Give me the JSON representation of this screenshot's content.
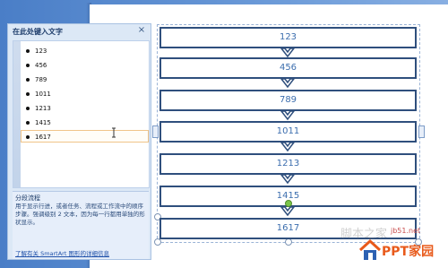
{
  "text_pane": {
    "title": "在此处键入文字",
    "close_label": "×",
    "items": [
      "123",
      "456",
      "789",
      "1011",
      "1213",
      "1415",
      "1617"
    ],
    "active_index": 6,
    "description_title": "分段流程",
    "description_body": "用于显示行进，或者任务、流程或工作流中的顺序步骤。强调级别 2 文本，因为每一行都用单独的形状显示。",
    "learn_more_link": "了解有关 SmartArt 图形的详细信息"
  },
  "smartart": {
    "steps": [
      "123",
      "456",
      "789",
      "1011",
      "1213",
      "1415",
      "1617"
    ],
    "box_border_color": "#2f4f7d",
    "text_color": "#3c6eae"
  },
  "watermark": {
    "site": "jb51.net",
    "logo_text": "PPT家园",
    "overlay_text": "脚本之家"
  },
  "colors": {
    "accent_orange": "#e85a1b",
    "pane_bg": "#dce8f6"
  }
}
